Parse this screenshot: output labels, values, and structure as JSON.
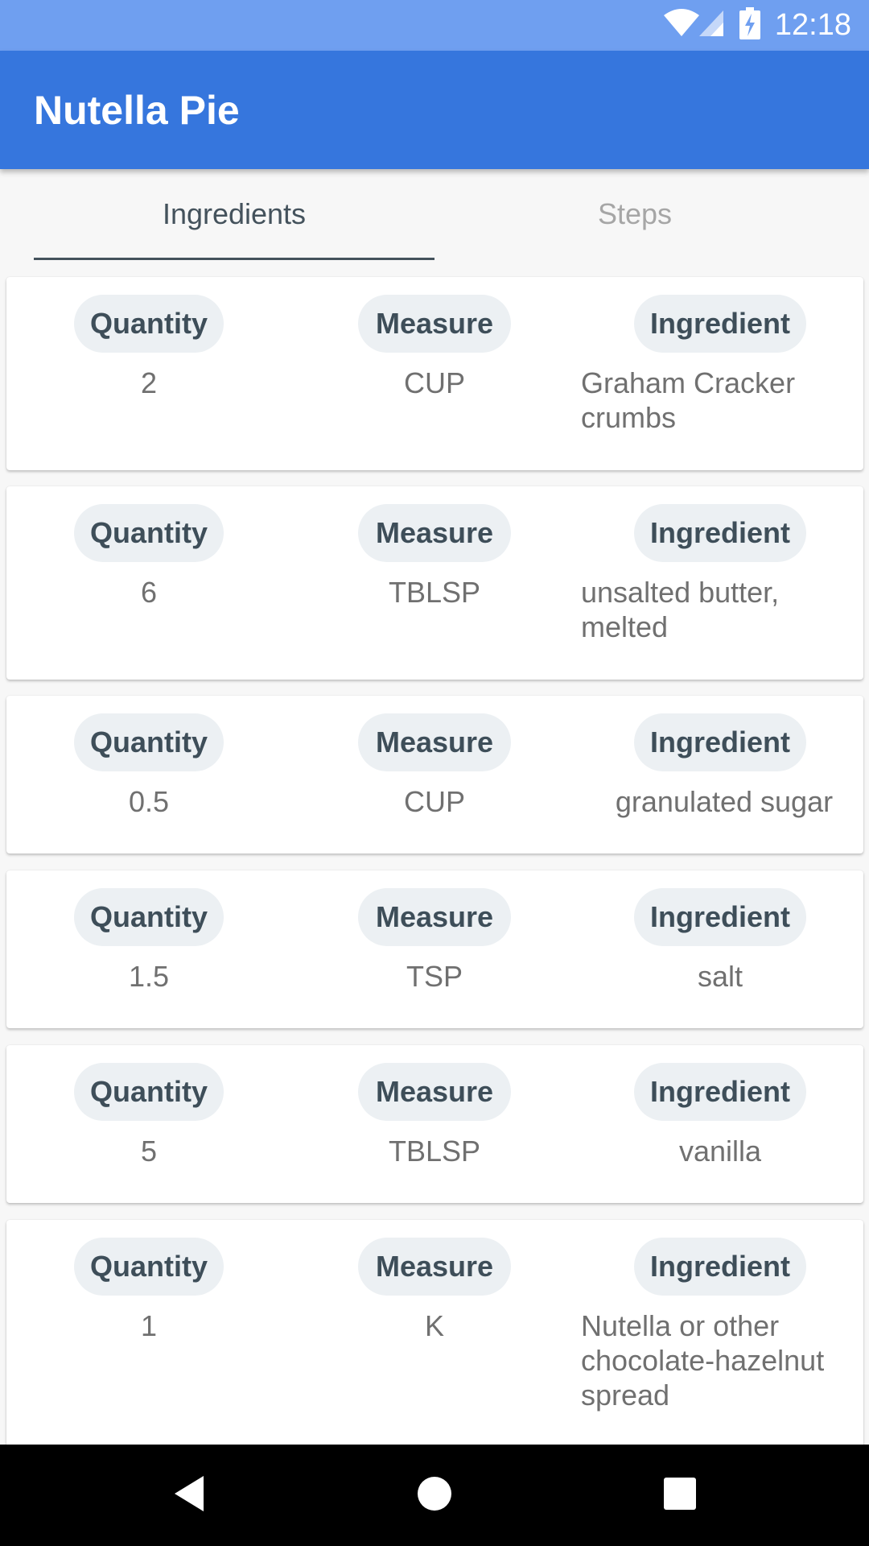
{
  "status_bar": {
    "time": "12:18",
    "icons": [
      "wifi-icon",
      "signal-icon",
      "battery-charging-icon"
    ]
  },
  "app_bar": {
    "title": "Nutella Pie"
  },
  "tabs": [
    {
      "label": "Ingredients",
      "selected": true
    },
    {
      "label": "Steps",
      "selected": false
    }
  ],
  "ingredients": [
    {
      "quantity_label": "Quantity",
      "measure_label": "Measure",
      "ingredient_label": "Ingredient",
      "quantity": "2",
      "measure": "CUP",
      "ingredient": "Graham Cracker crumbs"
    },
    {
      "quantity_label": "Quantity",
      "measure_label": "Measure",
      "ingredient_label": "Ingredient",
      "quantity": "6",
      "measure": "TBLSP",
      "ingredient": "unsalted butter, melted"
    },
    {
      "quantity_label": "Quantity",
      "measure_label": "Measure",
      "ingredient_label": "Ingredient",
      "quantity": "0.5",
      "measure": "CUP",
      "ingredient": "granulated sugar"
    },
    {
      "quantity_label": "Quantity",
      "measure_label": "Measure",
      "ingredient_label": "Ingredient",
      "quantity": "1.5",
      "measure": "TSP",
      "ingredient": "salt"
    },
    {
      "quantity_label": "Quantity",
      "measure_label": "Measure",
      "ingredient_label": "Ingredient",
      "quantity": "5",
      "measure": "TBLSP",
      "ingredient": "vanilla"
    },
    {
      "quantity_label": "Quantity",
      "measure_label": "Measure",
      "ingredient_label": "Ingredient",
      "quantity": "1",
      "measure": "K",
      "ingredient": "Nutella or other chocolate-hazelnut spread"
    }
  ],
  "nav_bar": {
    "buttons": [
      "back-icon",
      "home-icon",
      "recents-icon"
    ]
  },
  "colors": {
    "status_bar": "#6f9ff0",
    "app_bar": "#3676dd",
    "tab_selected": "#44525c",
    "tab_unselected": "#a6a6a6",
    "chip_bg": "#ecf0f3",
    "chip_text": "#3e4e59",
    "value_text": "#707070"
  }
}
